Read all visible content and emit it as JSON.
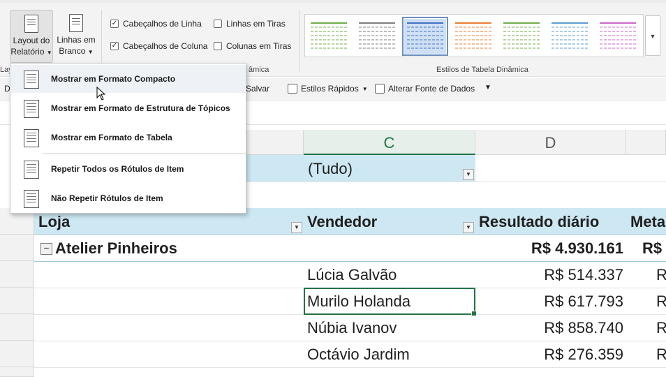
{
  "ribbon": {
    "layout_btn_line1": "Layout do",
    "layout_btn_line2": "Relatório",
    "blank_btn_line1": "Linhas em",
    "blank_btn_line2": "Branco",
    "group_left_label": "Lay",
    "options_group_label": "âmica",
    "chk_row_headers": "Cabeçalhos de Linha",
    "chk_col_headers": "Cabeçalhos de Coluna",
    "chk_banded_rows": "Linhas em Tiras",
    "chk_banded_cols": "Colunas em Tiras",
    "styles_group_label": "Estilos de Tabela Dinâmica",
    "style_colors": [
      "#70ad47",
      "#7f7f7f",
      "#4472c4",
      "#ed7d31",
      "#70ad47",
      "#5b9bd5",
      "#cc66cc"
    ]
  },
  "toolbar2": {
    "save_label": "Salvar",
    "quick_styles_label": "Estilos Rápidos",
    "change_source_label": "Alterar Fonte de Dados",
    "left_fragment": "D"
  },
  "columns": {
    "c": "C",
    "d": "D"
  },
  "filter": {
    "value": "(Tudo)"
  },
  "headers": {
    "store": "Loja",
    "seller": "Vendedor",
    "daily_result": "Resultado diário",
    "goal_fragment": "Meta"
  },
  "group": {
    "store_name": "Atelier Pinheiros",
    "total": "R$ 4.930.161",
    "goal_fragment": "R$"
  },
  "rows": [
    {
      "seller": "Lúcia Galvão",
      "value": "R$ 514.337",
      "goal_fragment": "R"
    },
    {
      "seller": "Murilo Holanda",
      "value": "R$ 617.793",
      "goal_fragment": "R"
    },
    {
      "seller": "Núbia Ivanov",
      "value": "R$ 858.740",
      "goal_fragment": "R"
    },
    {
      "seller": "Octávio Jardim",
      "value": "R$ 276.359",
      "goal_fragment": "R"
    }
  ],
  "menu": {
    "items": [
      {
        "label": "Mostrar em Formato Compacto"
      },
      {
        "label": "Mostrar em Formato de Estrutura de Tópicos"
      },
      {
        "label": "Mostrar em Formato de Tabela"
      },
      {
        "label": "Repetir Todos os Rótulos de Item"
      },
      {
        "label": "Não Repetir Rótulos de Item"
      }
    ]
  },
  "accent": {
    "excel_green": "#217346",
    "pivot_blue": "#cde8f3"
  }
}
